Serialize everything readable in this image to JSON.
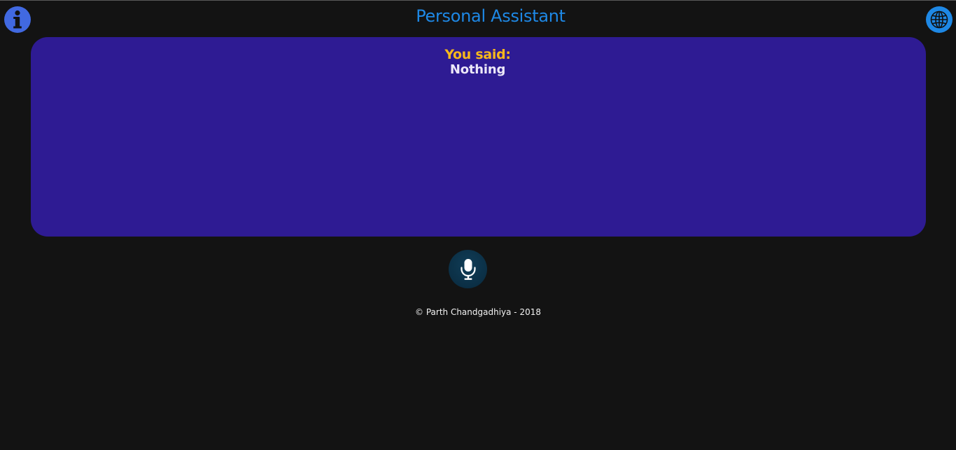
{
  "header": {
    "title": "Personal Assistant",
    "info_icon": "info-icon",
    "language_icon": "globe-icon"
  },
  "speech": {
    "label": "You said:",
    "text": "Nothing"
  },
  "mic": {
    "icon": "microphone-icon"
  },
  "footer": {
    "copyright": "© Parth Chandgadhiya - 2018"
  },
  "colors": {
    "background": "#131313",
    "accent_blue": "#1e88e5",
    "info_blue": "#4169e1",
    "panel": "#2e1b93",
    "label_yellow": "#f7b81b",
    "mic_button": "#0b2f45"
  }
}
